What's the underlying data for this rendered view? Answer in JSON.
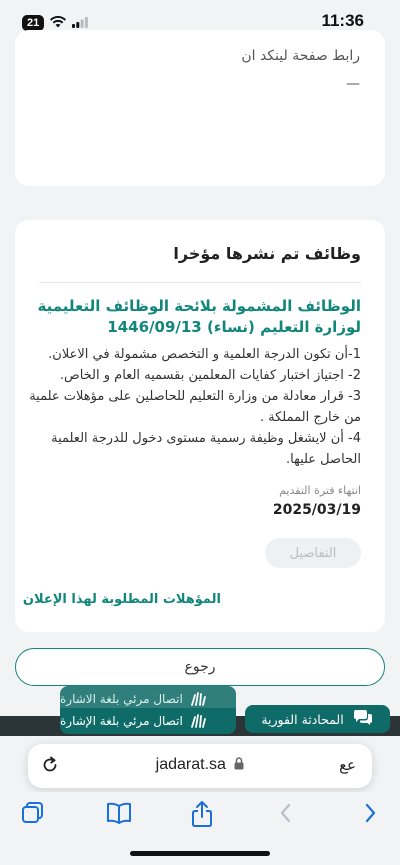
{
  "status_bar": {
    "time": "11:36",
    "battery": "21"
  },
  "top_card": {
    "linkedin_label": "رابط صفحة لينكد ان",
    "linkedin_value": "—"
  },
  "jobs_section": {
    "title": "وظائف تم نشرها مؤخرا",
    "job": {
      "title": "الوظائف المشمولة بلائحة الوظائف التعليمية لوزارة التعليم (نساء) 1446/09/13",
      "requirements": [
        "1-أن تكون الدرجة العلمية و التخصص مشمولة في الاعلان.",
        "2- اجتياز اختبار كفايات المعلمين بقسميه العام و الخاص.",
        "3- قرار معادلة من وزارة التعليم للحاصلين على مؤهلات علمية من خارج المملكة .",
        "4- أن لايشغل وظيفة رسمية مستوى دخول للدرجة العلمية الحاصل عليها."
      ],
      "deadline_label": "انتهاء فترة التقديم",
      "deadline_value": "2025/03/19",
      "details_label": "التفاصيل",
      "qualifications_link": "المؤهلات المطلوبة لهذا الإعلان"
    }
  },
  "back_button": "رجوع",
  "sign_language": {
    "label_back": "اتصال مرئي بلغة الاشارة",
    "label_front": "اتصال مرئي بلغة الإشارة"
  },
  "chat_button": "المحادثة الفورية",
  "browser": {
    "url": "jadarat.sa",
    "text_size_label": "عع"
  },
  "colors": {
    "brand": "#12867a",
    "brand_dark": "#0f6b68",
    "background": "#f1f3f5"
  },
  "icons": [
    "wifi-icon",
    "signal-icon",
    "reload-icon",
    "lock-icon",
    "tabs-icon",
    "bookmarks-icon",
    "share-icon",
    "back-arrow-icon",
    "forward-arrow-icon",
    "chat-bubble-icon",
    "sign-hand-icon"
  ]
}
